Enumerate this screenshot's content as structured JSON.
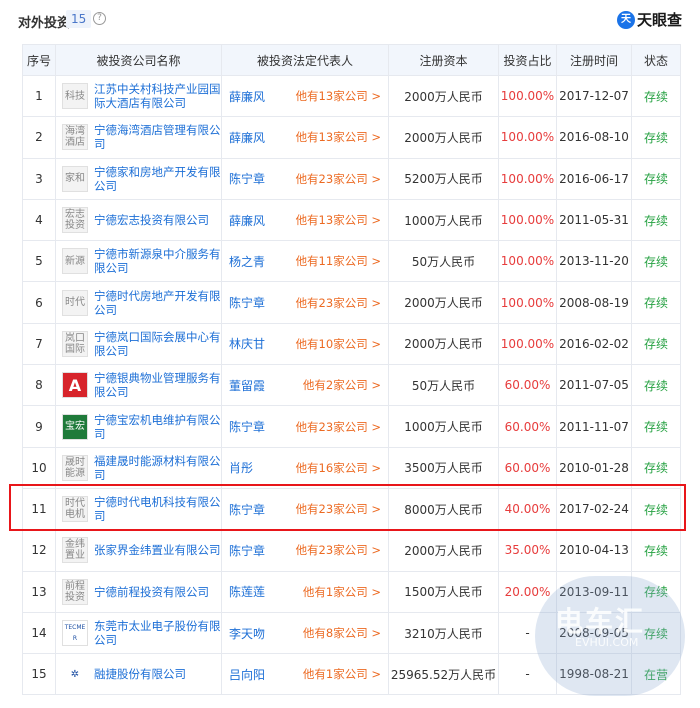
{
  "header": {
    "title": "对外投资",
    "count": "15",
    "help": "?",
    "brand_mark": "天",
    "brand_text": "天眼查"
  },
  "columns": [
    "序号",
    "被投资公司名称",
    "被投资法定代表人",
    "注册资本",
    "投资占比",
    "注册时间",
    "状态"
  ],
  "rows": [
    {
      "index": "1",
      "logo": "科技",
      "company": "江苏中关村科技产业园国际大酒店有限公司",
      "rep": "薛廉风",
      "more": "他有13家公司 >",
      "capital": "2000万人民币",
      "ratio": "100.00%",
      "date": "2017-12-07",
      "status": "存续"
    },
    {
      "index": "2",
      "logo": "海湾酒店",
      "company": "宁德海湾酒店管理有限公司",
      "rep": "薛廉风",
      "more": "他有13家公司 >",
      "capital": "2000万人民币",
      "ratio": "100.00%",
      "date": "2016-08-10",
      "status": "存续"
    },
    {
      "index": "3",
      "logo": "家和",
      "company": "宁德家和房地产开发有限公司",
      "rep": "陈宁章",
      "more": "他有23家公司 >",
      "capital": "5200万人民币",
      "ratio": "100.00%",
      "date": "2016-06-17",
      "status": "存续"
    },
    {
      "index": "4",
      "logo": "宏志投资",
      "company": "宁德宏志投资有限公司",
      "rep": "薛廉风",
      "more": "他有13家公司 >",
      "capital": "1000万人民币",
      "ratio": "100.00%",
      "date": "2011-05-31",
      "status": "存续"
    },
    {
      "index": "5",
      "logo": "新源",
      "company": "宁德市新源泉中介服务有限公司",
      "rep": "杨之青",
      "more": "他有11家公司 >",
      "capital": "50万人民币",
      "ratio": "100.00%",
      "date": "2013-11-20",
      "status": "存续"
    },
    {
      "index": "6",
      "logo": "时代",
      "company": "宁德时代房地产开发有限公司",
      "rep": "陈宁章",
      "more": "他有23家公司 >",
      "capital": "2000万人民币",
      "ratio": "100.00%",
      "date": "2008-08-19",
      "status": "存续"
    },
    {
      "index": "7",
      "logo": "岚口国际",
      "company": "宁德岚口国际会展中心有限公司",
      "rep": "林庆甘",
      "more": "他有10家公司 >",
      "capital": "2000万人民币",
      "ratio": "100.00%",
      "date": "2016-02-02",
      "status": "存续"
    },
    {
      "index": "8",
      "logo": "A",
      "company": "宁德银典物业管理服务有限公司",
      "rep": "董留霞",
      "more": "他有2家公司 >",
      "capital": "50万人民币",
      "ratio": "60.00%",
      "date": "2011-07-05",
      "status": "存续"
    },
    {
      "index": "9",
      "logo": "宝宏",
      "company": "宁德宝宏机电维护有限公司",
      "rep": "陈宁章",
      "more": "他有23家公司 >",
      "capital": "1000万人民币",
      "ratio": "60.00%",
      "date": "2011-11-07",
      "status": "存续"
    },
    {
      "index": "10",
      "logo": "晟时能源",
      "company": "福建晟时能源材料有限公司",
      "rep": "肖彤",
      "more": "他有16家公司 >",
      "capital": "3500万人民币",
      "ratio": "60.00%",
      "date": "2010-01-28",
      "status": "存续"
    },
    {
      "index": "11",
      "logo": "时代电机",
      "company": "宁德时代电机科技有限公司",
      "rep": "陈宁章",
      "more": "他有23家公司 >",
      "capital": "8000万人民币",
      "ratio": "40.00%",
      "date": "2017-02-24",
      "status": "存续"
    },
    {
      "index": "12",
      "logo": "金纬置业",
      "company": "张家界金纬置业有限公司",
      "rep": "陈宁章",
      "more": "他有23家公司 >",
      "capital": "2000万人民币",
      "ratio": "35.00%",
      "date": "2010-04-13",
      "status": "存续"
    },
    {
      "index": "13",
      "logo": "前程投资",
      "company": "宁德前程投资有限公司",
      "rep": "陈莲莲",
      "more": "他有1家公司 >",
      "capital": "1500万人民币",
      "ratio": "20.00%",
      "date": "2013-09-11",
      "status": "存续"
    },
    {
      "index": "14",
      "logo": "TECMER",
      "company": "东莞市太业电子股份有限公司",
      "rep": "李天吻",
      "more": "他有8家公司 >",
      "capital": "3210万人民币",
      "ratio": "-",
      "date": "2008-09-05",
      "status": "存续"
    },
    {
      "index": "15",
      "logo": "✲",
      "company": "融捷股份有限公司",
      "rep": "吕向阳",
      "more": "他有1家公司 >",
      "capital": "25965.52万人民币",
      "ratio": "-",
      "date": "1998-08-21",
      "status": "在营"
    }
  ],
  "watermark": {
    "main": "电车汇",
    "sub": "EVHUI.COM"
  },
  "colors": {
    "link": "#1d6fd6",
    "more": "#ec6a22",
    "ratio": "#e73c3c",
    "status": "#27a243",
    "highlight": "#e8161a"
  }
}
